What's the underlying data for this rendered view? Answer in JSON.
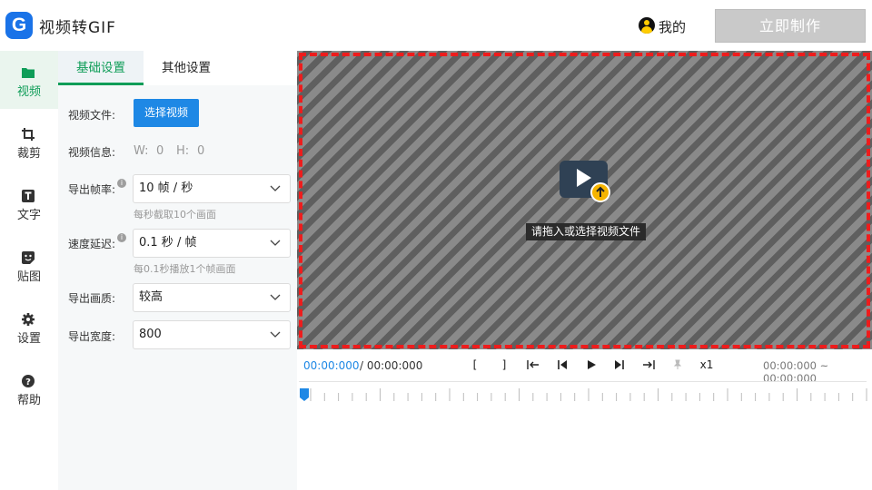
{
  "header": {
    "app_title": "视频转GIF",
    "user_label": "我的",
    "make_button": "立即制作"
  },
  "nav": {
    "items": [
      {
        "label": "视频",
        "icon": "folder-icon",
        "active": true
      },
      {
        "label": "裁剪",
        "icon": "crop-icon",
        "active": false
      },
      {
        "label": "文字",
        "icon": "text-icon",
        "active": false
      },
      {
        "label": "贴图",
        "icon": "sticker-icon",
        "active": false
      },
      {
        "label": "设置",
        "icon": "gear-icon",
        "active": false
      },
      {
        "label": "帮助",
        "icon": "help-icon",
        "active": false
      }
    ]
  },
  "panel": {
    "tabs": [
      "基础设置",
      "其他设置"
    ],
    "video_file_label": "视频文件:",
    "select_video_button": "选择视频",
    "video_info_label": "视频信息:",
    "width_label": "W:",
    "width_value": "0",
    "height_label": "H:",
    "height_value": "0",
    "fps_label": "导出帧率:",
    "fps_value": "10 帧 / 秒",
    "fps_hint": "每秒截取10个画面",
    "delay_label": "速度延迟:",
    "delay_value": "0.1 秒 / 帧",
    "delay_hint": "每0.1秒播放1个帧画面",
    "quality_label": "导出画质:",
    "quality_value": "较高",
    "width_export_label": "导出宽度:",
    "width_export_value": "800",
    "info_glyph": "i"
  },
  "stage": {
    "drop_text": "请拖入或选择视频文件"
  },
  "player": {
    "current_time": "00:00:000",
    "total_time": "/ 00:00:000",
    "mark_in": "[",
    "mark_out": "]",
    "speed": "x1",
    "range": "00:00:000 ~ 00:00:000"
  },
  "colors": {
    "brand": "#1a73e8",
    "accent_green": "#0f9d58",
    "button_blue": "#1e88e5",
    "dash_red": "#ee1c1c"
  }
}
